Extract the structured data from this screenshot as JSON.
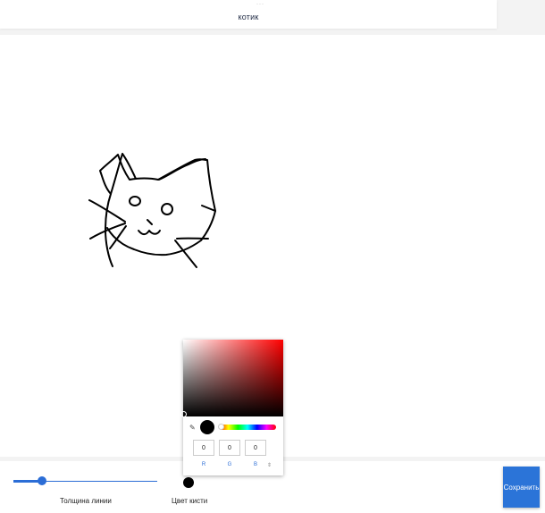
{
  "header": {
    "dots": "···",
    "title": "котик"
  },
  "canvas": {
    "drawing": "cat-sketch"
  },
  "controls": {
    "thickness_label": "Толщина линии",
    "thickness_value": 0.2,
    "color_label": "Цвет кисти",
    "brush_color": "#000000",
    "save_label": "Сохранить"
  },
  "color_picker": {
    "hue_color": "#ff0000",
    "r_value": "0",
    "g_value": "0",
    "b_value": "0",
    "r_label": "R",
    "g_label": "G",
    "b_label": "B",
    "mode_toggle": "⇕",
    "eyedropper_icon": "eyedropper-icon"
  },
  "colors": {
    "accent": "#2b6dd6",
    "button": "#2b74d8"
  }
}
